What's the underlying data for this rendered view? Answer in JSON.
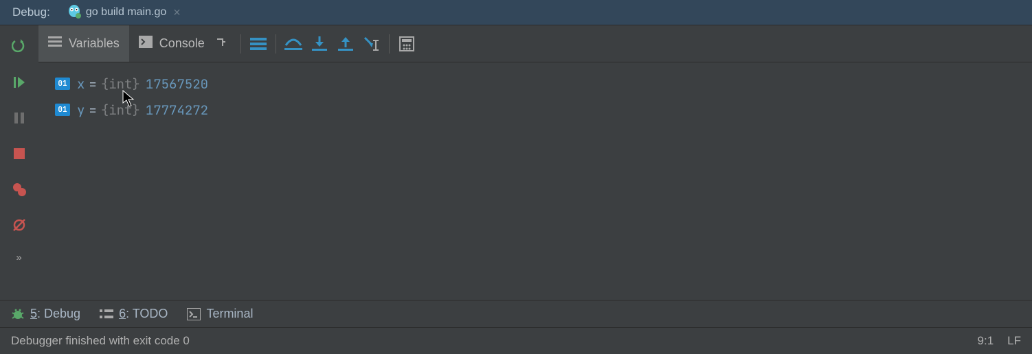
{
  "topbar": {
    "label": "Debug:",
    "tab": {
      "title": "go build main.go"
    }
  },
  "panes": {
    "variables_label": "Variables",
    "console_label": "Console"
  },
  "variables": [
    {
      "badge": "01",
      "name": "x",
      "eq": "=",
      "type": "{int}",
      "value": "17567520"
    },
    {
      "badge": "01",
      "name": "y",
      "eq": "=",
      "type": "{int}",
      "value": "17774272"
    }
  ],
  "toolwins": {
    "debug_key": "5",
    "debug_label": ": Debug",
    "todo_key": "6",
    "todo_label": ": TODO",
    "terminal_label": "Terminal"
  },
  "status": {
    "message": "Debugger finished with exit code 0",
    "pos": "9:1",
    "eol": "LF"
  }
}
